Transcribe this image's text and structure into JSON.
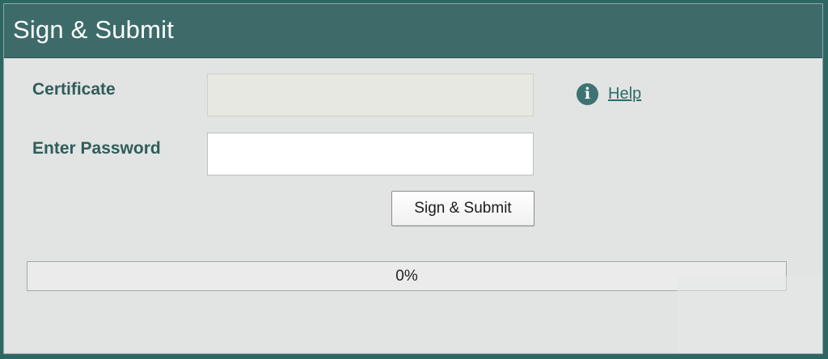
{
  "window": {
    "title": "Sign & Submit"
  },
  "form": {
    "certificate_label": "Certificate",
    "certificate_value": "",
    "password_label": "Enter Password",
    "password_value": "",
    "submit_label": "Sign & Submit"
  },
  "help": {
    "icon": "info-icon",
    "icon_glyph": "i",
    "link_label": "Help"
  },
  "progress": {
    "percent": 0,
    "label": "0%"
  },
  "colors": {
    "titlebar": "#3d6b69",
    "label": "#2f5d5b",
    "accent": "#3d7472",
    "background": "#e2e3e3"
  }
}
